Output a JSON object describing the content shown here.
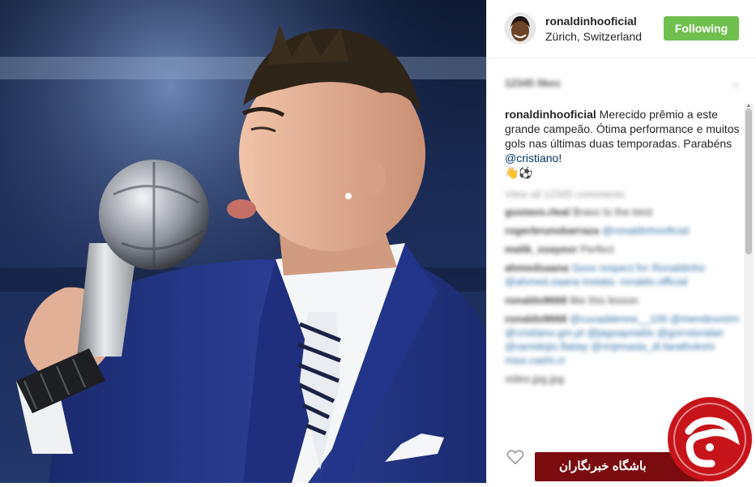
{
  "post": {
    "username": "ronaldinhooficial",
    "location": "Zürich, Switzerland",
    "follow_label": "Following",
    "likes": "12345 likes",
    "caption_user": "ronaldinhooficial",
    "caption_text": " Merecido prêmio a este grande campeão. Ótima performance e muitos gols nas últimas duas temporadas. Parabéns ",
    "caption_mention": "@cristiano",
    "caption_end": "!",
    "caption_emoji": "👋⚽",
    "view_all": "View all 12345 comments"
  },
  "comments": [
    {
      "user": "gustavo.rleal",
      "text": "Bravo to the best"
    },
    {
      "user": "rogerbrunobarraza",
      "text": "@ronaldinhooficial"
    },
    {
      "user": "malik_ssayeor",
      "text": "Perfect"
    },
    {
      "user": "ahmedsaana",
      "text": "Sooo respect for Ronaldinho @ahmed.saana Instata: ronaldo.official"
    },
    {
      "user": "ronaldo9668",
      "text": "like this lesson"
    },
    {
      "user": "ronaldo9668",
      "text": "@cuvaddenne__109 @mendesreirn @cristiano.gm.pt @jagoapriaitis @gorrstoralan @ramidojis.flaitay @rinjimasla_dl.farathokshi miss.cashi.cr"
    },
    {
      "user": "",
      "text": "video.jpg.jpg"
    }
  ],
  "watermark": {
    "text": "باشگاه خبرنگاران",
    "logo_letter": "ج"
  },
  "colors": {
    "follow_bg": "#70c050",
    "watermark_red": "#7a0c10",
    "mention": "#003569"
  },
  "icons": [
    "heart-icon",
    "chevron-down-icon",
    "scroll-up-icon",
    "scroll-down-icon"
  ]
}
